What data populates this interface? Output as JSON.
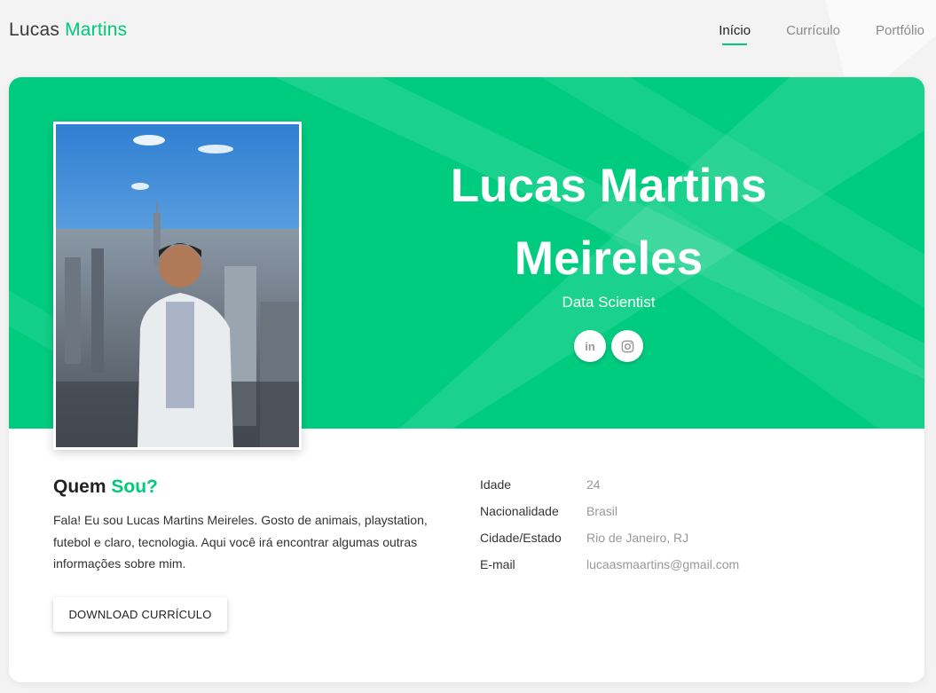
{
  "brand": {
    "first": "Lucas",
    "last": "Martins"
  },
  "nav": {
    "items": [
      {
        "label": "Início",
        "active": true
      },
      {
        "label": "Currículo",
        "active": false
      },
      {
        "label": "Portfólio",
        "active": false
      }
    ]
  },
  "hero": {
    "name_line1": "Lucas Martins",
    "name_line2": "Meireles",
    "title": "Data Scientist",
    "socials": [
      {
        "icon": "linkedin-icon",
        "glyph": "in"
      },
      {
        "icon": "instagram-icon"
      }
    ]
  },
  "about": {
    "heading_plain": "Quem",
    "heading_accent": "Sou?",
    "text": "Fala! Eu sou Lucas Martins Meireles. Gosto de animais, playstation, futebol e claro, tecnologia. Aqui você irá encontrar algumas outras informações sobre mim.",
    "download_label": "DOWNLOAD CURRÍCULO"
  },
  "info": [
    {
      "label": "Idade",
      "value": "24"
    },
    {
      "label": "Nacionalidade",
      "value": "Brasil"
    },
    {
      "label": "Cidade/Estado",
      "value": "Rio de Janeiro, RJ"
    },
    {
      "label": "E-mail",
      "value": "lucaasmaartins@gmail.com"
    }
  ],
  "colors": {
    "accent": "#00c97b",
    "hero_bg": "#00cc80",
    "page_bg": "#f3f3f3"
  }
}
